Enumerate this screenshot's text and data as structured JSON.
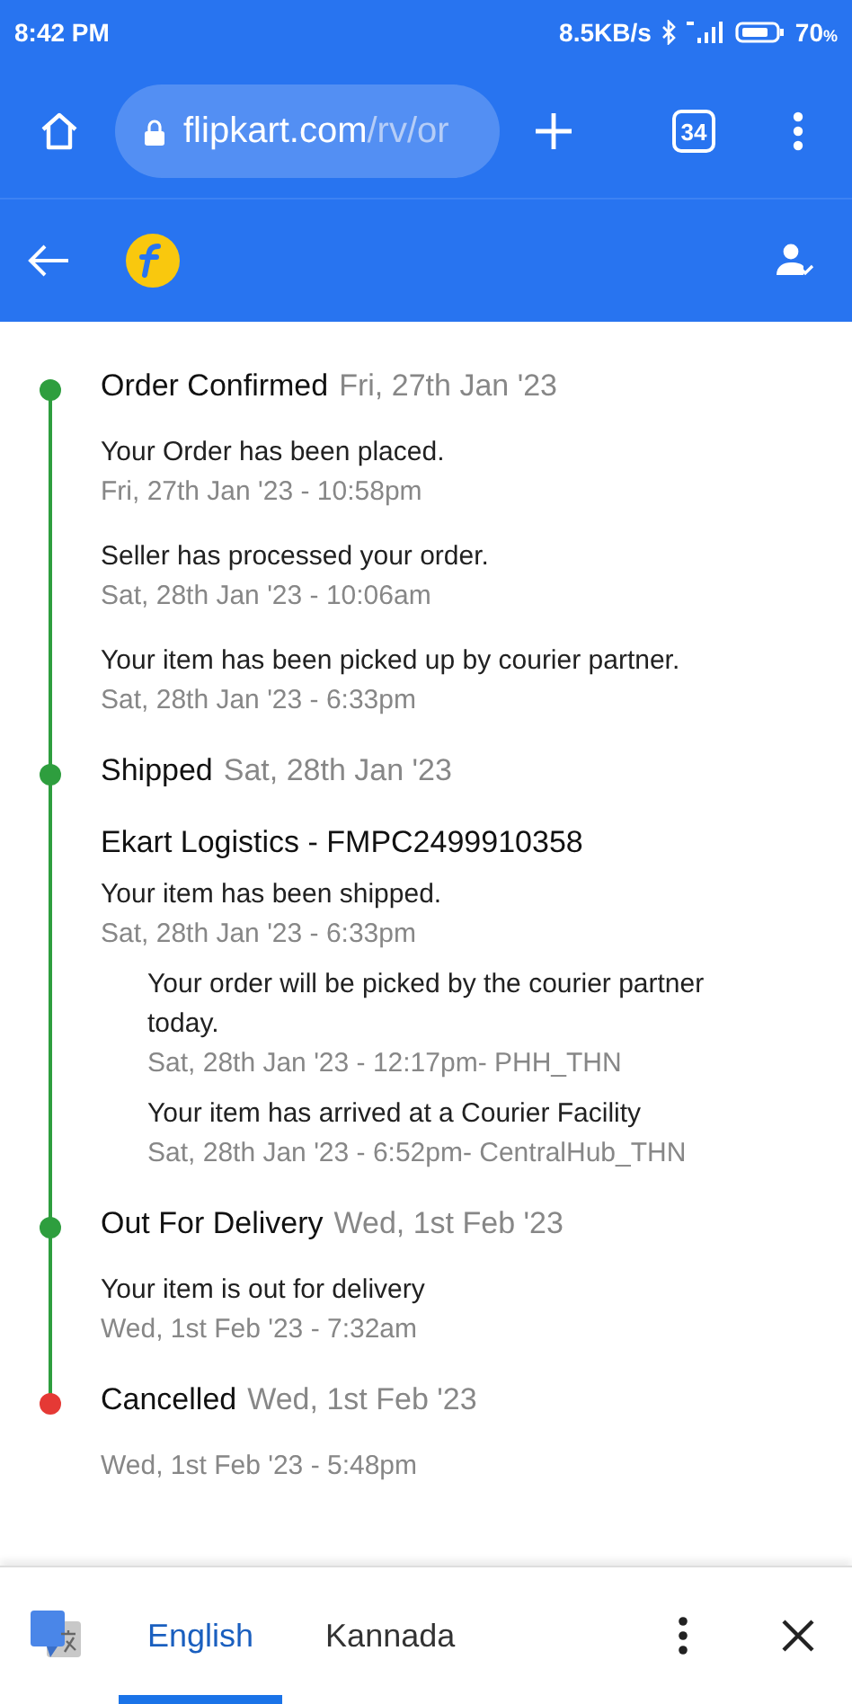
{
  "status_bar": {
    "time": "8:42 PM",
    "speed": "8.5KB/s",
    "battery": "70",
    "battery_unit": "%"
  },
  "browser": {
    "url_host": "flipkart.com",
    "url_path": "/rv/or",
    "tab_count": "34"
  },
  "timeline": [
    {
      "title": "Order Confirmed",
      "date": "Fri, 27th Jan '23",
      "color": "#2e9e3e",
      "events": [
        {
          "text": "Your Order has been placed.",
          "time": "Fri, 27th Jan '23 - 10:58pm"
        },
        {
          "text": "Seller has processed your order.",
          "time": "Sat, 28th Jan '23 - 10:06am"
        },
        {
          "text": "Your item has been picked up by courier partner.",
          "time": "Sat, 28th Jan '23 - 6:33pm"
        }
      ]
    },
    {
      "title": "Shipped",
      "date": "Sat, 28th Jan '23",
      "color": "#2e9e3e",
      "courier": "Ekart Logistics - FMPC2499910358",
      "events": [
        {
          "text": "Your item has been shipped.",
          "time": "Sat, 28th Jan '23 - 6:33pm",
          "sub_events": [
            {
              "text": "Your order will be picked by the courier partner today.",
              "time": "Sat, 28th Jan '23 - 12:17pm- PHH_THN"
            },
            {
              "text": "Your item has arrived at a Courier Facility",
              "time": "Sat, 28th Jan '23 - 6:52pm- CentralHub_THN"
            }
          ]
        }
      ]
    },
    {
      "title": "Out For Delivery",
      "date": "Wed, 1st Feb '23",
      "color": "#2e9e3e",
      "events": [
        {
          "text": "Your item is out for delivery",
          "time": "Wed, 1st Feb '23 - 7:32am"
        }
      ]
    },
    {
      "title": "Cancelled",
      "date": "Wed, 1st Feb '23",
      "color": "#e53935",
      "events": [
        {
          "time": "Wed, 1st Feb '23 - 5:48pm"
        }
      ]
    }
  ],
  "translate_bar": {
    "languages": [
      {
        "label": "English",
        "selected": true
      },
      {
        "label": "Kannada",
        "selected": false
      }
    ]
  }
}
